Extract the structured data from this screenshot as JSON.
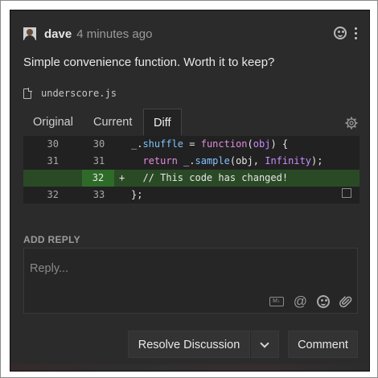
{
  "comment": {
    "author": "dave",
    "time": "4 minutes ago",
    "body": "Simple convenience function. Worth it to keep?"
  },
  "file": {
    "name": "underscore.js"
  },
  "tabs": [
    {
      "label": "Original"
    },
    {
      "label": "Current"
    },
    {
      "label": "Diff"
    }
  ],
  "diff": {
    "rows": [
      {
        "old": "30",
        "new": "30",
        "marker": ""
      },
      {
        "old": "31",
        "new": "31",
        "marker": ""
      },
      {
        "old": "",
        "new": "32",
        "marker": "+"
      },
      {
        "old": "32",
        "new": "33",
        "marker": ""
      }
    ],
    "tokens": {
      "r1_a": "_.",
      "r1_b": "shuffle",
      "r1_c": " = ",
      "r1_d": "function",
      "r1_e": "(",
      "r1_f": "obj",
      "r1_g": ") {",
      "r2_a": "  ",
      "r2_b": "return",
      "r2_c": " _.",
      "r2_d": "sample",
      "r2_e": "(obj, ",
      "r2_f": "Infinity",
      "r2_g": ");",
      "r3_a": "  // This code has changed!",
      "r4_a": "};"
    }
  },
  "reply": {
    "label": "ADD REPLY",
    "placeholder": "Reply...",
    "md_badge": "M↓",
    "at_symbol": "@"
  },
  "buttons": {
    "resolve": "Resolve Discussion",
    "comment": "Comment"
  },
  "colors": {
    "panel_bg": "#2b2b2b",
    "added_line_bg": "#2a4a26",
    "added_gutter_bg": "#2f6b28",
    "keyword_pink": "#e38be0",
    "identifier_blue": "#7fc2ff"
  },
  "icons": [
    "avatar",
    "emoji-icon",
    "kebab-menu-icon",
    "file-icon",
    "gear-icon",
    "open-external-icon",
    "markdown-icon",
    "mention-icon",
    "emoji-icon",
    "paperclip-icon",
    "chevron-down-icon"
  ]
}
